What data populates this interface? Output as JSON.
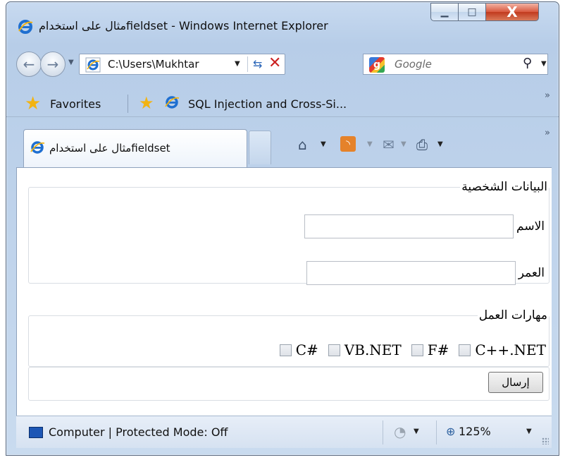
{
  "window": {
    "title": "مثال على استخدامfieldset - Windows Internet Explorer",
    "minimize_glyph": "▁",
    "maximize_glyph": "□",
    "close_glyph": "X"
  },
  "navigation": {
    "address": "C:\\Users\\Mukhtar",
    "search_placeholder": "Google",
    "search_logo_letter": "g"
  },
  "favorites_bar": {
    "favorites_label": "Favorites",
    "links": [
      {
        "label": "SQL Injection and Cross-Si..."
      }
    ],
    "more_glyph": "»"
  },
  "tabs": [
    {
      "label": "مثال على استخدامfieldset",
      "active": true
    }
  ],
  "form": {
    "personal": {
      "legend": "البيانات الشخصية",
      "name_label": "الاسم",
      "name_value": "",
      "age_label": "العمر",
      "age_value": ""
    },
    "skills": {
      "legend": "مهارات العمل",
      "options": [
        {
          "label": "C++.NET",
          "checked": false
        },
        {
          "label": "F#",
          "checked": false
        },
        {
          "label": "VB.NET",
          "checked": false
        },
        {
          "label": "C#",
          "checked": false
        }
      ]
    },
    "submit_label": "إرسال"
  },
  "status_bar": {
    "text": "Computer | Protected Mode: Off",
    "zoom": "125%"
  },
  "icons": {
    "page": "ie-logo-icon",
    "favorites": "star-icon",
    "add_favorite": "add-to-favorites-icon",
    "home": "home-icon",
    "feeds": "rss-feed-icon",
    "mail": "mail-icon",
    "print": "printer-icon",
    "refresh": "refresh-icon",
    "stop": "stop-icon",
    "search": "search-icon"
  },
  "colors": {
    "chrome": "#c8daf0",
    "close_button": "#d9583e",
    "ie_blue": "#1f6fd0",
    "ie_gold": "#f2b312"
  }
}
